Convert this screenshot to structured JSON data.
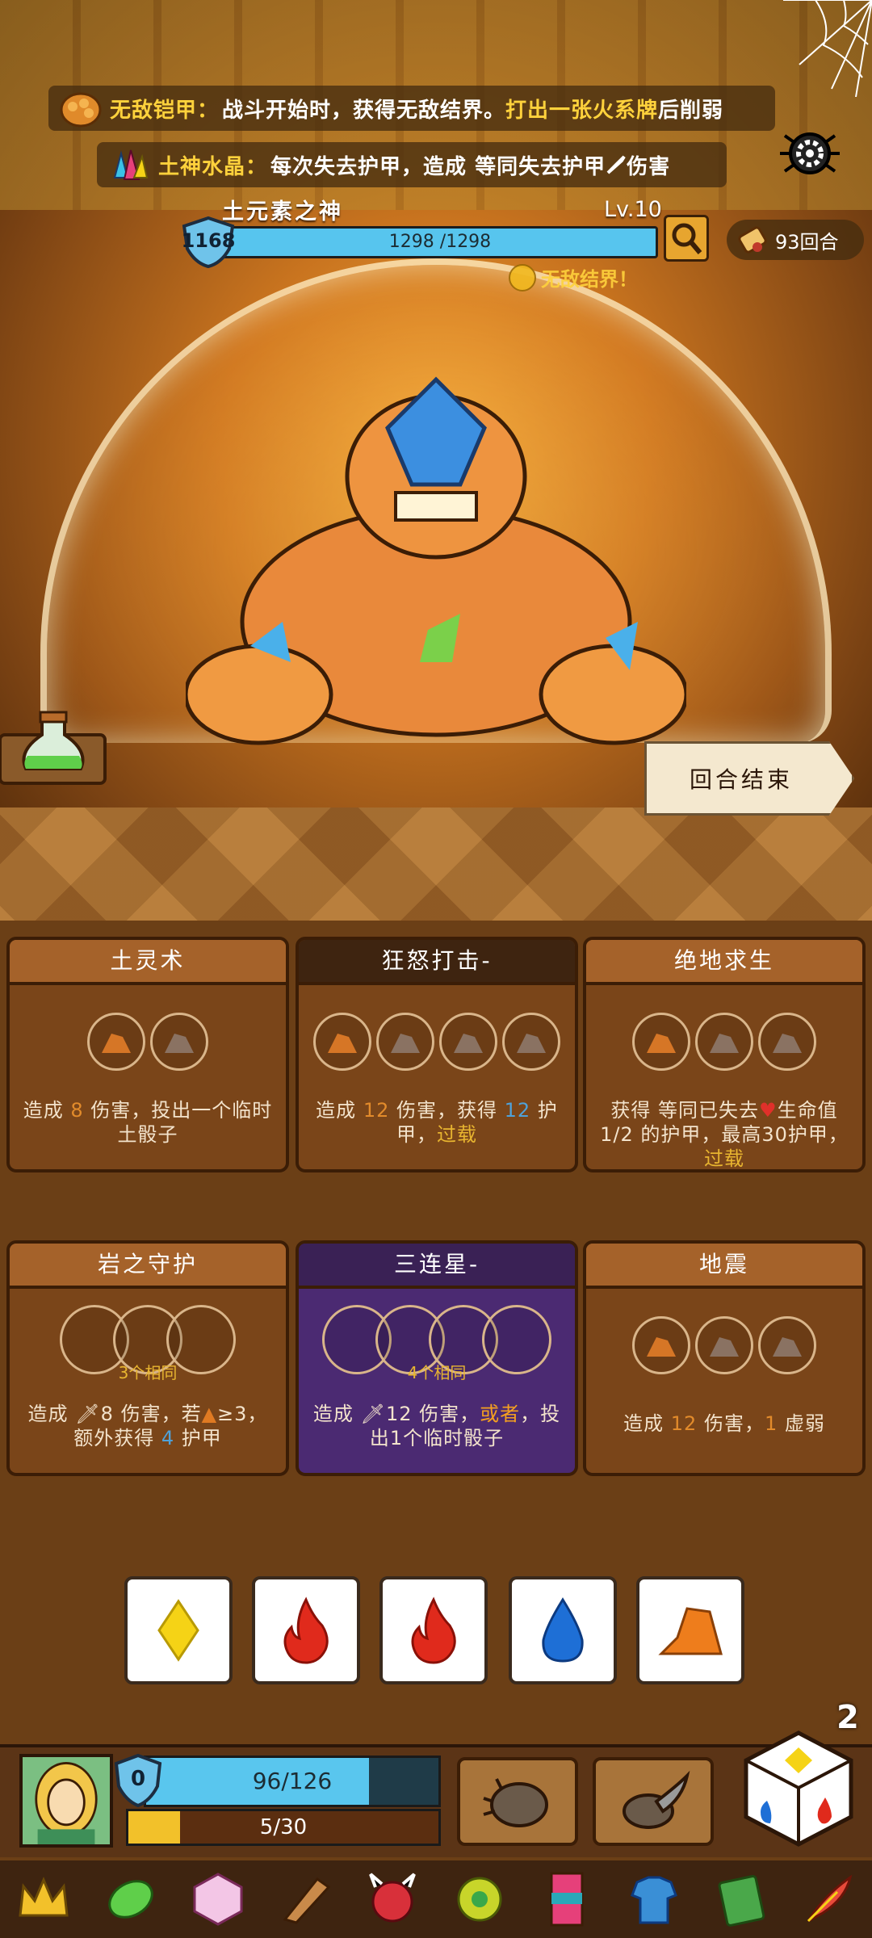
{
  "passives": [
    {
      "name": "无敌铠甲：",
      "text_a": "战斗开始时，获得无敌结界。",
      "highlight": "打出一张火系牌",
      "text_b": "后削弱"
    },
    {
      "name": "土神水晶：",
      "text_a": "每次失去护甲，造成 等同失去护甲",
      "text_b": "伤害"
    }
  ],
  "boss": {
    "name": "土元素之神",
    "level": "Lv.10",
    "armor": "1168",
    "hp_text": "1298 /1298",
    "hp_fraction": 1.0,
    "status": "无敌结界！"
  },
  "round_counter": "93回合",
  "end_turn_label": "回合结束",
  "cards": [
    {
      "title": "土灵术",
      "desc_a": "造成 ",
      "num": "8",
      "desc_b": " 伤害，投出一个临时土骰子"
    },
    {
      "title": "狂怒打击-",
      "desc_a": "造成 ",
      "num": "12",
      "desc_b": " 伤害，获得 ",
      "num2": "12",
      "desc_c": " 护甲，",
      "kw": "过载"
    },
    {
      "title": "绝地求生",
      "desc_a": "获得 等同已失去",
      "desc_b": "生命值1/2 的护甲，最高30护甲，",
      "kw": "过载"
    },
    {
      "title": "岩之守护",
      "combo": "3个相同",
      "desc_a": "造成 ",
      "num": "8",
      "desc_b": " 伤害，若",
      "desc_c": "≥3，额外获得 ",
      "num2": "4",
      "desc_d": " 护甲"
    },
    {
      "title": "三连星-",
      "combo": "4个相同",
      "desc_a": "造成 ",
      "num": "12",
      "desc_b": " 伤害，",
      "kw": "或者",
      "desc_c": "，投出1个临时骰子"
    },
    {
      "title": "地震",
      "desc_a": "造成 ",
      "num": "12",
      "desc_b": " 伤害，",
      "num2": "1",
      "desc_c": " 虚弱"
    }
  ],
  "dice": [
    "yellow-diamond-icon",
    "fire-icon",
    "fire-icon",
    "water-drop-icon",
    "earth-rock-icon"
  ],
  "reroll_count": "2",
  "player": {
    "armor": "0",
    "hp_text": "96/126",
    "hp_fraction": 0.762,
    "xp_text": "5/30",
    "xp_fraction": 0.167
  },
  "colors": {
    "earth": "#e07a22",
    "fire": "#e02a1c",
    "water": "#1e6fd6",
    "air": "#f5d316",
    "hp": "#57c5ee",
    "xp": "#f2c12a"
  }
}
